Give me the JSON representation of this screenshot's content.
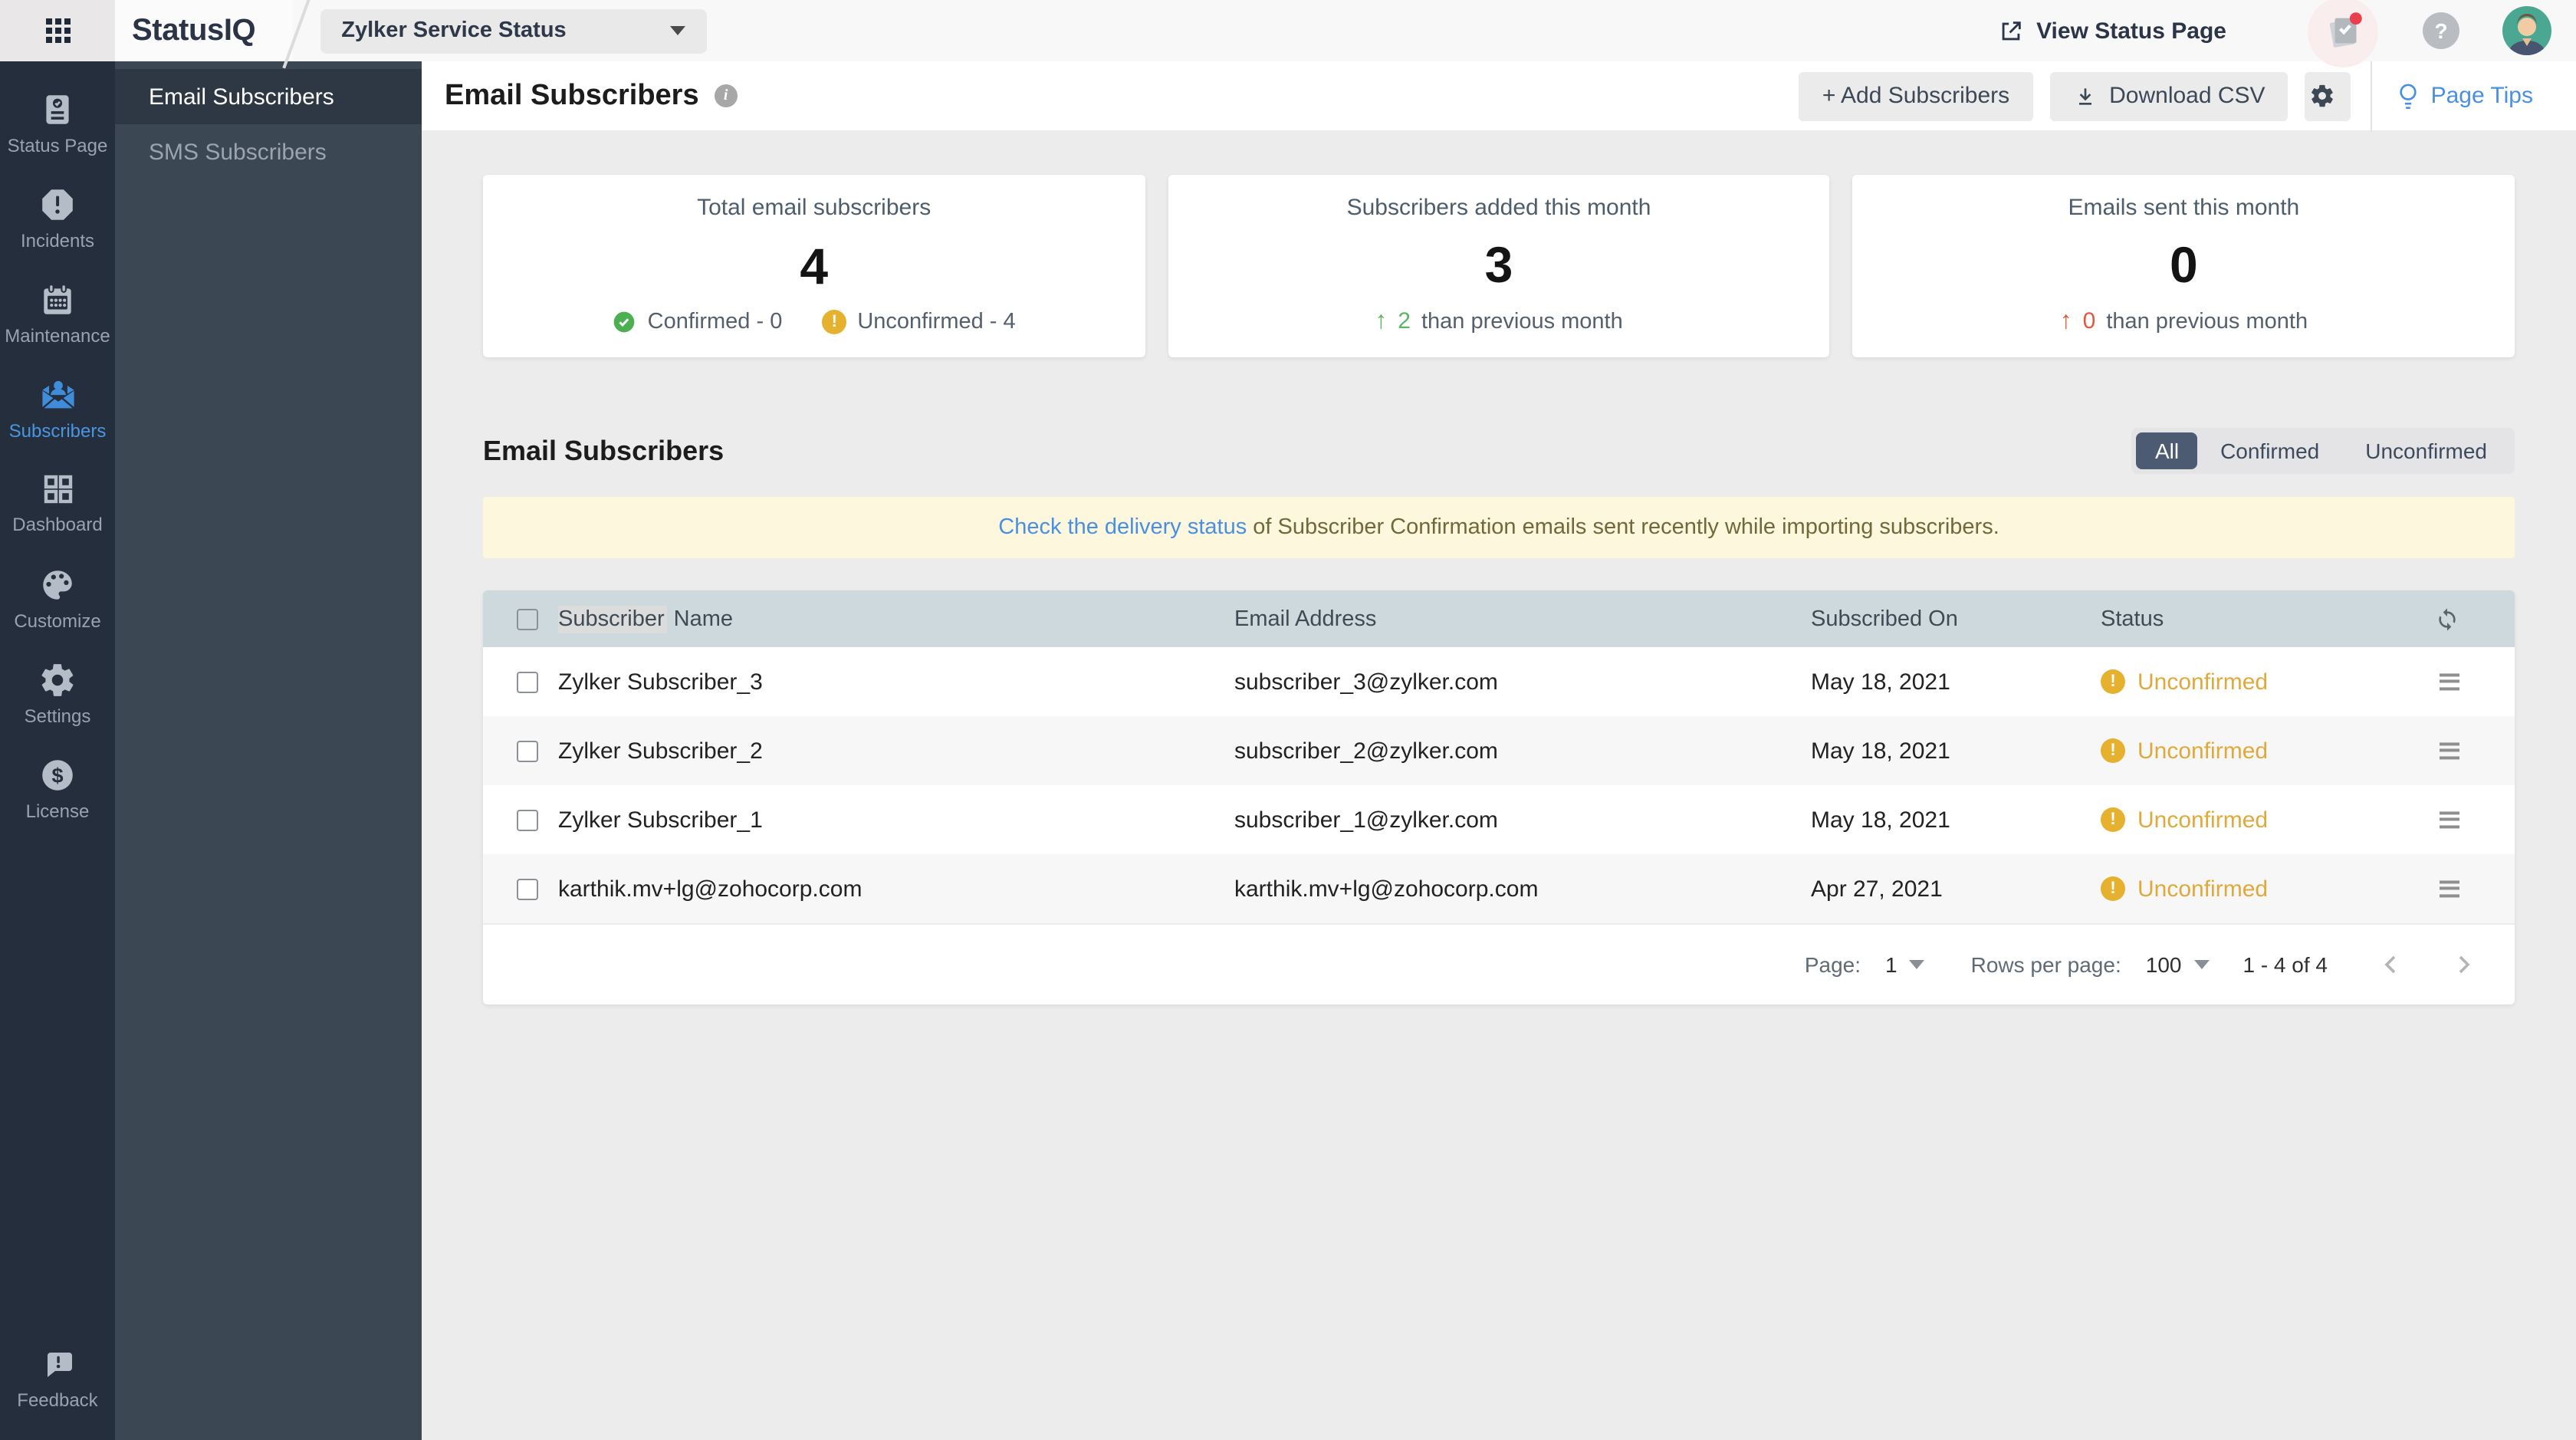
{
  "topbar": {
    "logo": "StatusIQ",
    "portal_selector": "Zylker Service Status",
    "view_status_page": "View Status Page"
  },
  "sidebar": {
    "items": [
      {
        "label": "Status Page",
        "icon": "status-page-icon"
      },
      {
        "label": "Incidents",
        "icon": "incidents-icon"
      },
      {
        "label": "Maintenance",
        "icon": "maintenance-icon"
      },
      {
        "label": "Subscribers",
        "icon": "subscribers-icon",
        "active": true
      },
      {
        "label": "Dashboard",
        "icon": "dashboard-icon"
      },
      {
        "label": "Customize",
        "icon": "customize-icon"
      },
      {
        "label": "Settings",
        "icon": "settings-icon"
      },
      {
        "label": "License",
        "icon": "license-icon"
      }
    ],
    "feedback": {
      "label": "Feedback",
      "icon": "feedback-icon"
    }
  },
  "subnav": {
    "items": [
      {
        "label": "Email Subscribers",
        "active": true
      },
      {
        "label": "SMS Subscribers"
      }
    ]
  },
  "header": {
    "title": "Email Subscribers",
    "add_button": "+ Add Subscribers",
    "download_button": "Download CSV",
    "page_tips": "Page Tips"
  },
  "stats": {
    "total": {
      "title": "Total email subscribers",
      "value": "4",
      "confirmed": "Confirmed - 0",
      "unconfirmed": "Unconfirmed - 4"
    },
    "added": {
      "title": "Subscribers added this month",
      "value": "3",
      "delta_value": "2",
      "delta_text": "than previous month"
    },
    "sent": {
      "title": "Emails sent this month",
      "value": "0",
      "delta_value": "0",
      "delta_text": "than previous month"
    }
  },
  "section": {
    "title": "Email Subscribers",
    "filters": [
      {
        "label": "All"
      },
      {
        "label": "Confirmed"
      },
      {
        "label": "Unconfirmed"
      }
    ],
    "active_filter": "All",
    "banner_link": "Check the delivery status",
    "banner_text": "of Subscriber Confirmation emails sent recently while importing subscribers."
  },
  "table": {
    "header": {
      "name_highlight": "Subscriber",
      "name_rest": "Name",
      "email": "Email Address",
      "date": "Subscribed On",
      "status": "Status"
    },
    "rows": [
      {
        "name": "Zylker Subscriber_3",
        "email": "subscriber_3@zylker.com",
        "date": "May 18, 2021",
        "status": "Unconfirmed"
      },
      {
        "name": "Zylker Subscriber_2",
        "email": "subscriber_2@zylker.com",
        "date": "May 18, 2021",
        "status": "Unconfirmed"
      },
      {
        "name": "Zylker Subscriber_1",
        "email": "subscriber_1@zylker.com",
        "date": "May 18, 2021",
        "status": "Unconfirmed"
      },
      {
        "name": "karthik.mv+lg@zohocorp.com",
        "email": "karthik.mv+lg@zohocorp.com",
        "date": "Apr 27, 2021",
        "status": "Unconfirmed"
      }
    ],
    "pagination": {
      "page_label": "Page:",
      "page_value": "1",
      "rows_label": "Rows per page:",
      "rows_value": "100",
      "range": "1 - 4 of 4"
    }
  },
  "icons": {
    "up_arrow": "↑"
  },
  "colors": {
    "accent_blue": "#4a90e2",
    "active_nav_blue": "#3f8cdb",
    "green": "#5cb661",
    "red": "#e2593f",
    "yellow": "#e5b12e",
    "sidebar_bg": "#242e3c",
    "subnav_bg": "#3c4754",
    "table_header_bg": "#cdd9dd",
    "banner_bg": "#fcf7dd"
  }
}
